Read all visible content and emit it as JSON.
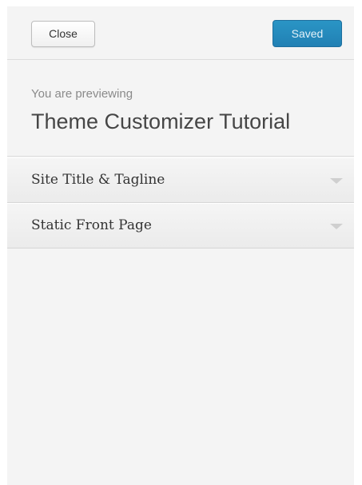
{
  "header": {
    "close_label": "Close",
    "saved_label": "Saved"
  },
  "info": {
    "previewing_label": "You are previewing",
    "theme_name": "Theme Customizer Tutorial"
  },
  "sections": [
    {
      "label": "Site Title & Tagline",
      "icon": "chevron-down-icon"
    },
    {
      "label": "Static Front Page",
      "icon": "chevron-down-icon"
    }
  ],
  "colors": {
    "primary_button": "#2a95c5",
    "panel_background": "#f4f4f4"
  }
}
